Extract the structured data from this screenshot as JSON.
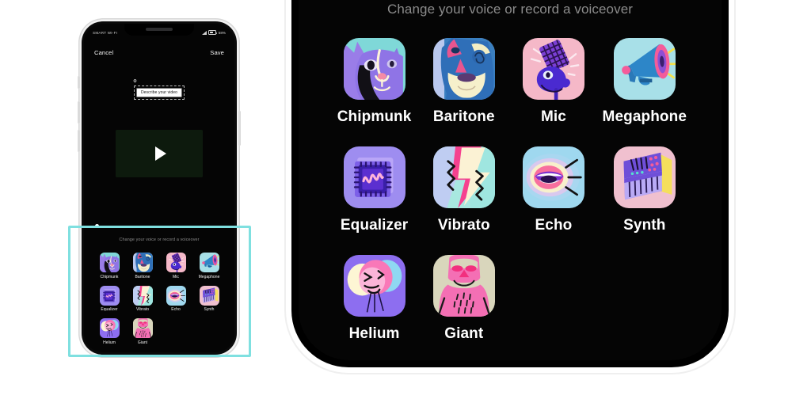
{
  "colors": {
    "highlight": "#7fe0e0",
    "screen_bg": "#050505",
    "caption": "#8b8b8b",
    "label": "#ffffff",
    "device_frame": "#ffffff"
  },
  "small_phone": {
    "status_bar": {
      "carrier": "SMART WI-FI",
      "battery_percent": "58%",
      "wifi_icon": "wifi-icon",
      "battery_icon": "battery-icon"
    },
    "navbar": {
      "cancel_label": "Cancel",
      "save_label": "Save"
    },
    "tooltip": {
      "text": "Describe your video",
      "gear_icon": "gear-icon"
    },
    "video": {
      "play_icon": "play-icon"
    },
    "scrubber": {
      "position_percent": 0
    },
    "caption": "Change your voice or record a voiceover"
  },
  "big_phone": {
    "caption": "Change your voice or record a voiceover"
  },
  "effects": [
    {
      "label": "Chipmunk",
      "art": "chipmunk",
      "bg": "#7fd8d8"
    },
    {
      "label": "Baritone",
      "art": "baritone",
      "bg": "#b9c8ee"
    },
    {
      "label": "Mic",
      "art": "mic",
      "bg": "#f5b8c8"
    },
    {
      "label": "Megaphone",
      "art": "megaphone",
      "bg": "#a8e0e8"
    },
    {
      "label": "Equalizer",
      "art": "equalizer",
      "bg": "#9e8df0"
    },
    {
      "label": "Vibrato",
      "art": "vibrato",
      "bg": "#a8e8e0"
    },
    {
      "label": "Echo",
      "art": "echo",
      "bg": "#9fd8ef"
    },
    {
      "label": "Synth",
      "art": "synth",
      "bg": "#f0c0cf"
    },
    {
      "label": "Helium",
      "art": "helium",
      "bg": "#8d6ef0"
    },
    {
      "label": "Giant",
      "art": "giant",
      "bg": "#d9d6bc"
    }
  ]
}
